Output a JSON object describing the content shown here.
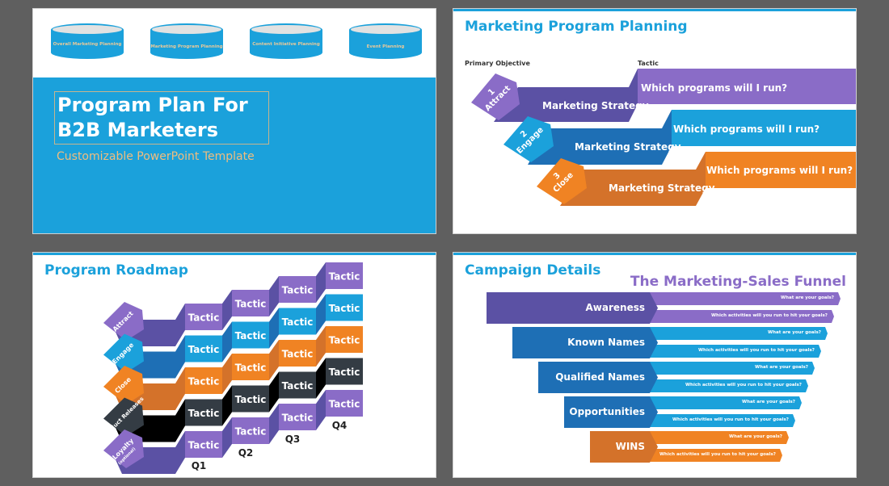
{
  "colors": {
    "blue": "#1ba1db",
    "purple": "#8a6cc7",
    "dark_purple": "#5b51a4",
    "dark_blue": "#1e6fb5",
    "orange": "#f08323",
    "dark_orange": "#d4722a",
    "charcoal": "#343c44",
    "background": "#5f5f5f",
    "subtitle_gold": "#f0bd7e"
  },
  "slide1": {
    "cylinders": [
      "Overall Marketing Planning",
      "Marketing Program Planning",
      "Content Initiative Planning",
      "Event Planning"
    ],
    "title_line1": "Program Plan For",
    "title_line2": "B2B Marketers",
    "subtitle": "Customizable PowerPoint Template"
  },
  "slide2": {
    "title": "Marketing Program Planning",
    "col_primary": "Primary Objective",
    "col_tactic": "Tactic",
    "rows": [
      {
        "num": "1",
        "objective": "Attract",
        "strategy": "Marketing Strategy",
        "question": "Which programs will I run?"
      },
      {
        "num": "2",
        "objective": "Engage",
        "strategy": "Marketing Strategy",
        "question": "Which programs will I run?"
      },
      {
        "num": "3",
        "objective": "Close",
        "strategy": "Marketing Strategy",
        "question": "Which programs will I run?"
      }
    ]
  },
  "slide3": {
    "title": "Program Roadmap",
    "rows": [
      {
        "label": "Attract",
        "sub": ""
      },
      {
        "label": "Engage",
        "sub": ""
      },
      {
        "label": "Close",
        "sub": ""
      },
      {
        "label": "Product Releases",
        "sub": ""
      },
      {
        "label": "Loyalty",
        "sub": "(optional)"
      }
    ],
    "tactic_label": "Tactic",
    "quarters": [
      "Q1",
      "Q2",
      "Q3",
      "Q4"
    ]
  },
  "slide4": {
    "title": "Campaign Details",
    "funnel_title": "The Marketing-Sales Funnel",
    "stages": [
      {
        "label": "Awareness",
        "goal": "What are your goals?",
        "activities": "Which activities will you run to hit your goals?"
      },
      {
        "label": "Known Names",
        "goal": "What are your goals?",
        "activities": "Which activities will you run to hit your goals?"
      },
      {
        "label": "Qualified Names",
        "goal": "What are your goals?",
        "activities": "Which activities will you run to hit your goals?"
      },
      {
        "label": "Opportunities",
        "goal": "What are your goals?",
        "activities": "Which activities will you run to hit your goals?"
      },
      {
        "label": "WINS",
        "goal": "What are your goals?",
        "activities": "Which activities will you run to hit your goals?"
      }
    ]
  }
}
